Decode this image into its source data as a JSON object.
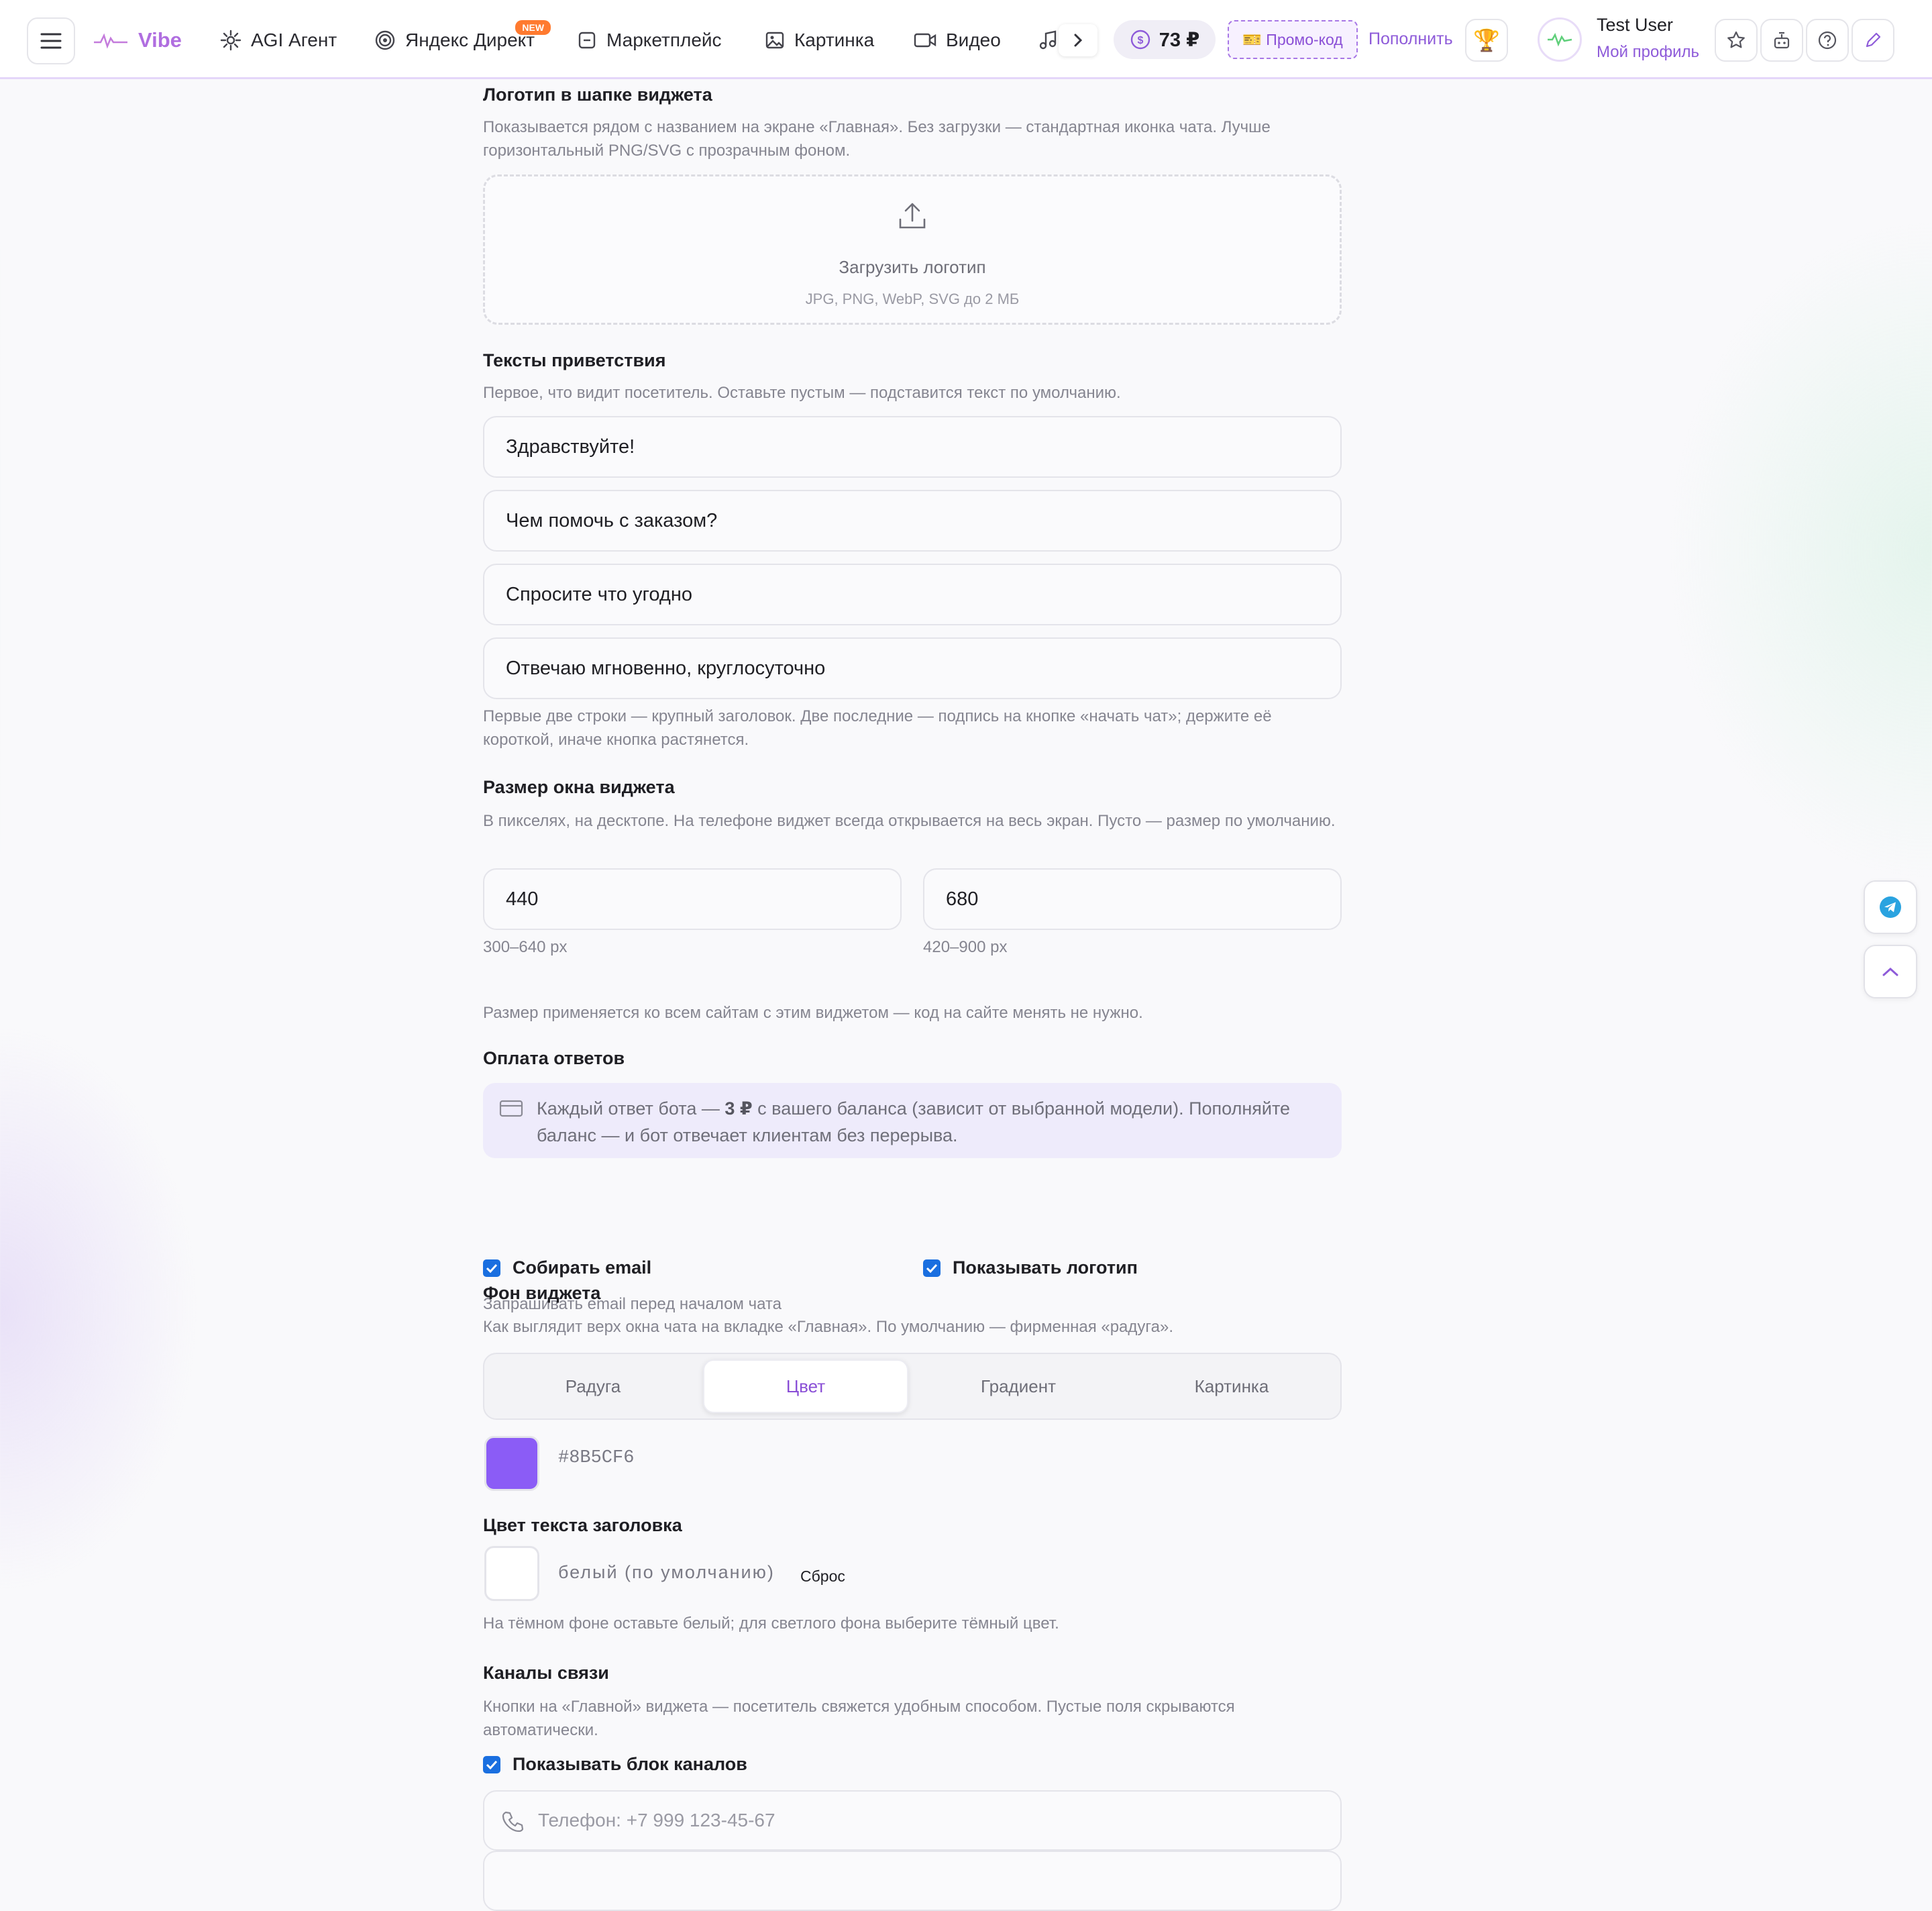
{
  "topbar": {
    "brand": "Vibe",
    "nav": [
      {
        "label": "AGI Агент",
        "icon": "sparkle-icon"
      },
      {
        "label": "Яндекс Директ",
        "icon": "target-icon",
        "badge": "NEW"
      },
      {
        "label": "Маркетплейс",
        "icon": "store-icon"
      },
      {
        "label": "Картинка",
        "icon": "image-icon"
      },
      {
        "label": "Видео",
        "icon": "video-icon"
      }
    ],
    "balance": "73 ₽",
    "promo": "🎫 Промо-код",
    "topup": "Пополнить",
    "trophy": "🏆",
    "user": {
      "name": "Test User",
      "link": "Мой профиль"
    }
  },
  "logo_section": {
    "title": "Логотип в шапке виджета",
    "hint": "Показывается рядом с названием на экране «Главная». Без загрузки — стандартная иконка чата. Лучше горизонтальный PNG/SVG с прозрачным фоном.",
    "upload_label": "Загрузить логотип",
    "upload_formats": "JPG, PNG, WebP, SVG до 2 МБ"
  },
  "greeting": {
    "title": "Тексты приветствия",
    "hint": "Первое, что видит посетитель. Оставьте пустым — подставится текст по умолчанию.",
    "lines": [
      "Здравствуйте!",
      "Чем помочь с заказом?",
      "Спросите что угодно",
      "Отвечаю мгновенно, круглосуточно"
    ],
    "footer_hint": "Первые две строки — крупный заголовок. Две последние — подпись на кнопке «начать чат»; держите её короткой, иначе кнопка растянется."
  },
  "size": {
    "title": "Размер окна виджета",
    "hint": "В пикселях, на десктопе. На телефоне виджет всегда открывается на весь экран. Пусто — размер по умолчанию.",
    "width_value": "440",
    "width_range": "300–640 px",
    "height_value": "680",
    "height_range": "420–900 px",
    "note": "Размер применяется ко всем сайтам с этим виджетом — код на сайте менять не нужно."
  },
  "payment": {
    "title": "Оплата ответов",
    "text_before": "Каждый ответ бота — ",
    "price": "3 ₽",
    "text_after": " с вашего баланса (зависит от выбранной модели). Пополняйте баланс — и бот отвечает клиентам без перерыва."
  },
  "options": {
    "collect_email": "Собирать email",
    "collect_email_hint": "Запрашивать email перед началом чата",
    "show_logo": "Показывать логотип"
  },
  "background": {
    "title": "Фон виджета",
    "hint": "Как выглядит верх окна чата на вкладке «Главная». По умолчанию — фирменная «радуга».",
    "tabs": [
      "Радуга",
      "Цвет",
      "Градиент",
      "Картинка"
    ],
    "active_tab": "Цвет",
    "color": "#8B5CF6"
  },
  "title_color": {
    "title": "Цвет текста заголовка",
    "value": "белый (по умолчанию)",
    "reset": "Сброс",
    "hint": "На тёмном фоне оставьте белый; для светлого фона выберите тёмный цвет."
  },
  "channels": {
    "title": "Каналы связи",
    "hint": "Кнопки на «Главной» виджета — посетитель свяжется удобным способом. Пустые поля скрываются автоматически.",
    "show_block": "Показывать блок каналов",
    "phone_placeholder": "Телефон: +7 999 123-45-67"
  },
  "colors": {
    "accent": "#8B5CF6",
    "brand": "#B06EE0",
    "checkbox": "#1A6FE0"
  }
}
